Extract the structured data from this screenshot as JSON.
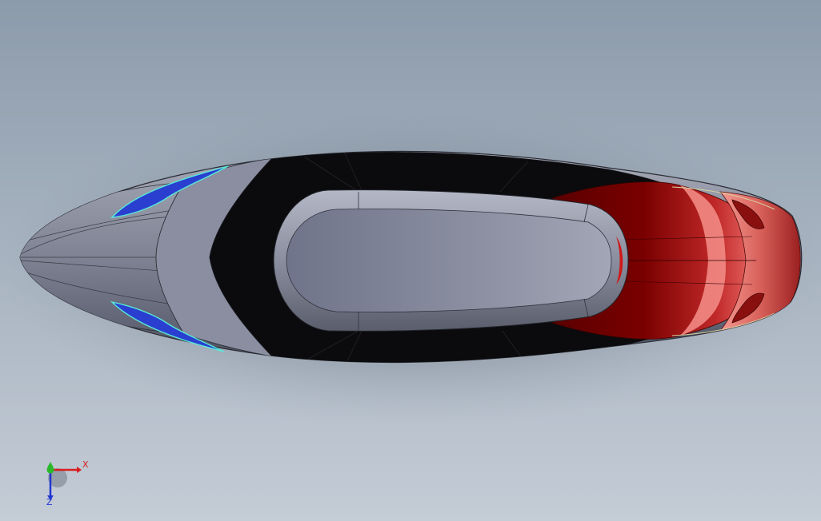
{
  "viewport": {
    "background_top": "#8c9bab",
    "background_bottom": "#c4ccd6"
  },
  "model": {
    "name": "shoe-sole-top-view",
    "colors": {
      "body_gray": "#8a8e9c",
      "body_dark_gray": "#5e6270",
      "black_insole": "#0b0b0d",
      "heel_dark_red": "#6a0000",
      "heel_red": "#b01a1a",
      "heel_pink": "#f28a84",
      "blue_detail": "#2a3fd0",
      "cyan_detail": "#58e8d8",
      "purple_edge": "#5a2070"
    }
  },
  "triad": {
    "x_label": "X",
    "z_label": "Z",
    "x_color": "#d81e1e",
    "y_color": "#2ab82a",
    "z_color": "#2036d0"
  }
}
